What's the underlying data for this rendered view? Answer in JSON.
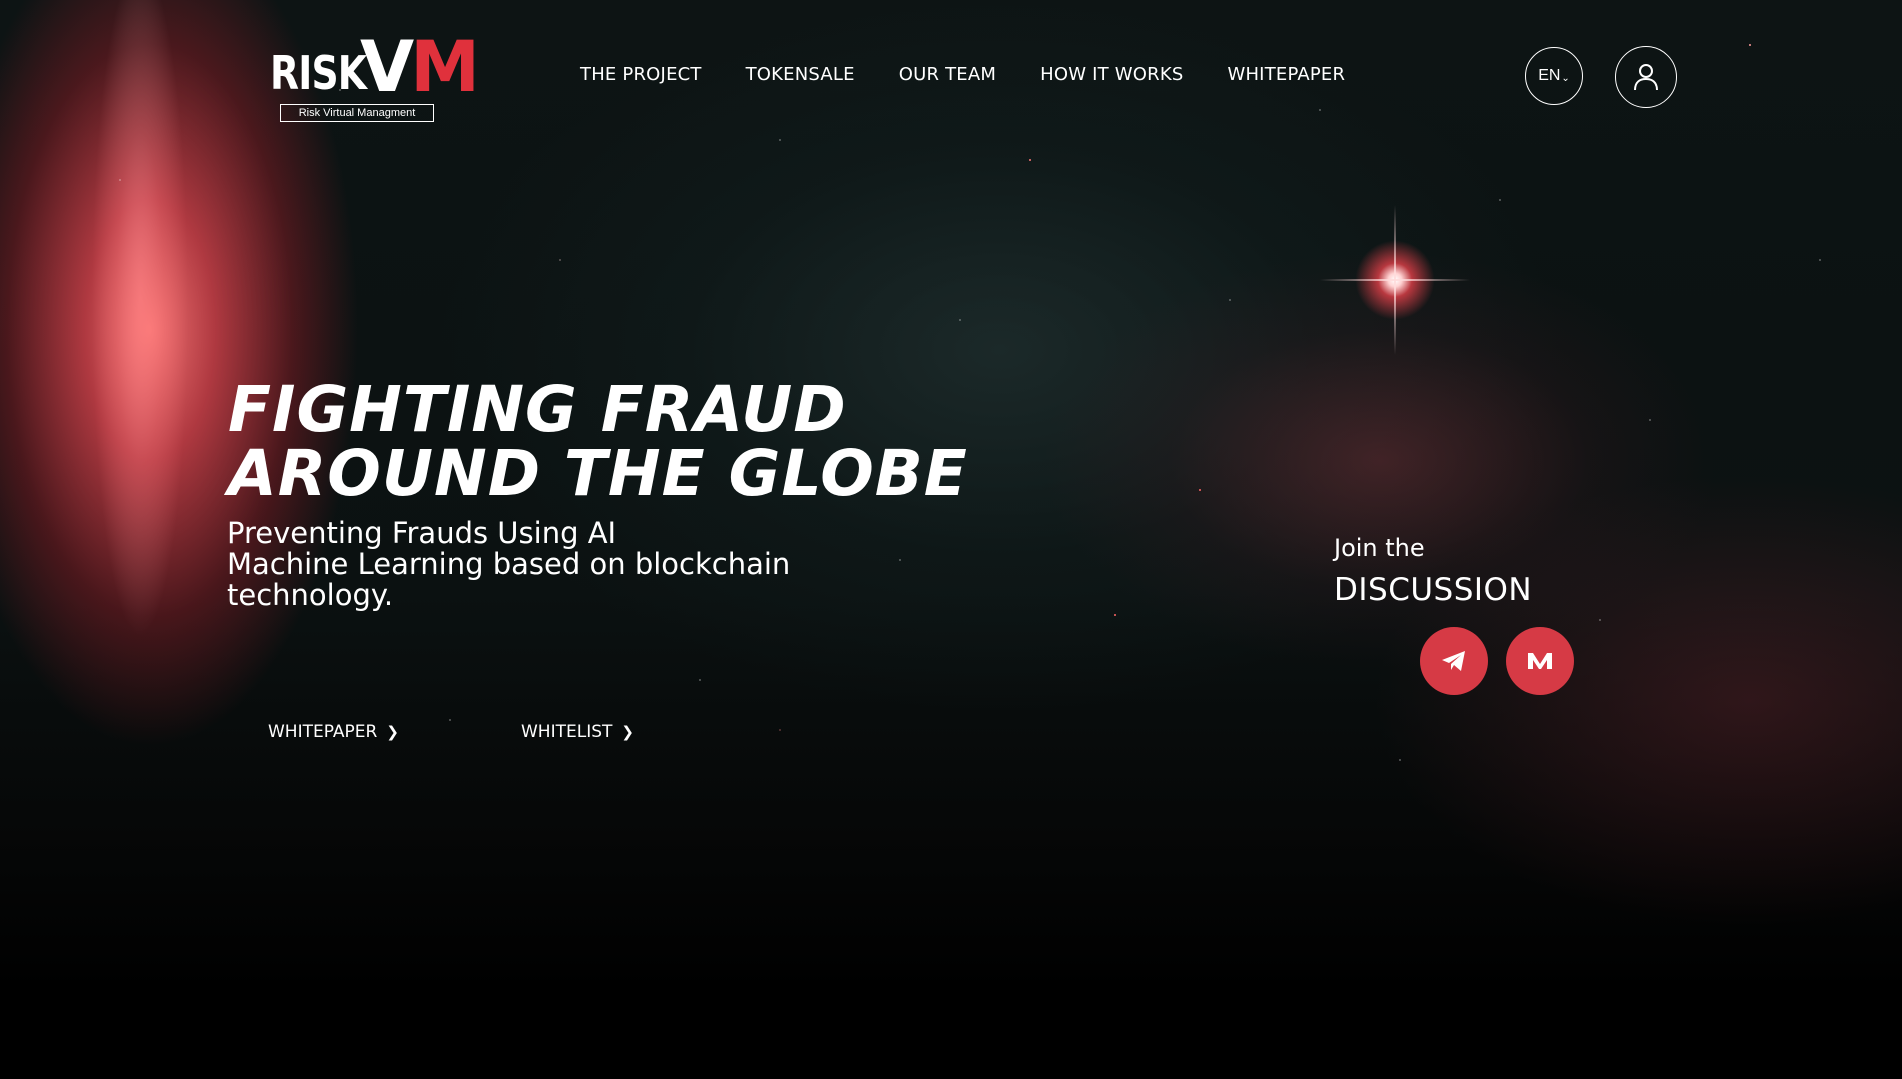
{
  "header": {
    "logo": {
      "word": "RISK",
      "vm_v": "V",
      "vm_m": "M",
      "tagline": "Risk Virtual Managment"
    },
    "nav": [
      {
        "label": "THE PROJECT"
      },
      {
        "label": "TOKENSALE"
      },
      {
        "label": "OUR TEAM"
      },
      {
        "label": "HOW IT WORKS"
      },
      {
        "label": "WHITEPAPER"
      }
    ],
    "language": "EN",
    "user_icon": "user-icon"
  },
  "hero": {
    "title_line1": "FIGHTING FRAUD",
    "title_line2": "AROUND THE GLOBE",
    "subtitle_line1": "Preventing Frauds Using AI",
    "subtitle_line2": "Machine Learning based on blockchain",
    "subtitle_line3": "technology.",
    "cta_whitepaper": "WHITEPAPER",
    "cta_whitelist": "WHITELIST"
  },
  "discussion": {
    "join": "Join the",
    "title": "DISCUSSION",
    "links": [
      {
        "icon": "telegram-icon"
      },
      {
        "icon": "medium-icon"
      }
    ]
  },
  "colors": {
    "accent": "#e0313c",
    "social_button": "#d63a45",
    "background": "#000000"
  }
}
